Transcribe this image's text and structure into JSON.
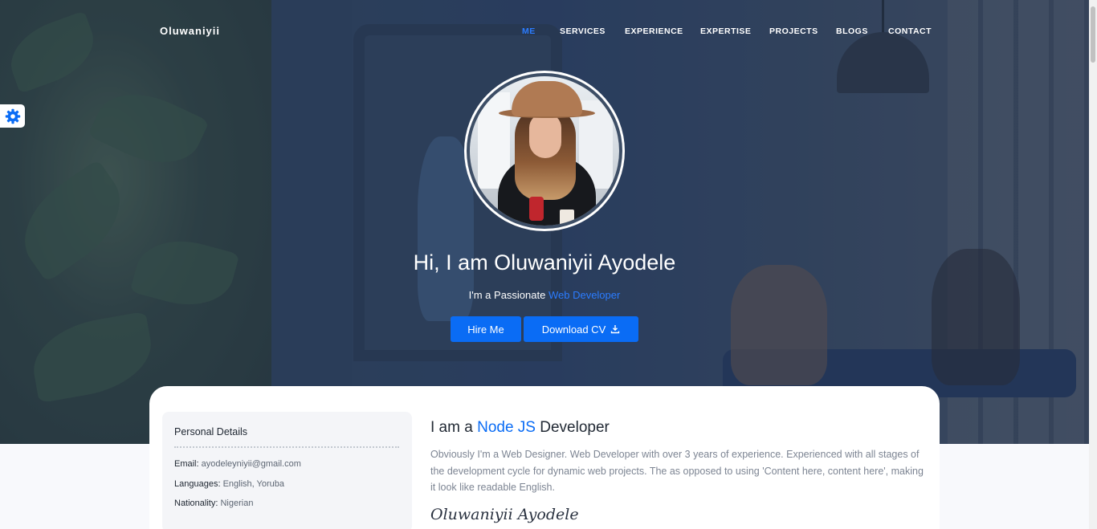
{
  "brand": "Oluwaniyii",
  "nav": {
    "items": [
      {
        "label": "ME",
        "active": true
      },
      {
        "label": "SERVICES",
        "active": false
      },
      {
        "label": "EXPERIENCE",
        "active": false
      },
      {
        "label": "EXPERTISE",
        "active": false
      },
      {
        "label": "PROJECTS",
        "active": false
      },
      {
        "label": "BLOGS",
        "active": false
      },
      {
        "label": "CONTACT",
        "active": false
      }
    ]
  },
  "settings": {
    "icon": "gear-icon"
  },
  "hero": {
    "title": "Hi, I am Oluwaniyii Ayodele",
    "subtitle_prefix": "I'm a Passionate",
    "subtitle_role": "Web Developer",
    "hire_label": "Hire Me",
    "cv_label": "Download CV",
    "cv_icon": "download-icon"
  },
  "personal_details": {
    "title": "Personal Details",
    "rows": [
      {
        "key": "Email:",
        "value": "ayodeleyniyii@gmail.com"
      },
      {
        "key": "Languages:",
        "value": "English, Yoruba"
      },
      {
        "key": "Nationality:",
        "value": "Nigerian"
      }
    ]
  },
  "about": {
    "heading_prefix": "I am a",
    "heading_accent": "Node JS",
    "heading_suffix": "Developer",
    "text": "Obviously I'm a Web Designer. Web Developer with over 3 years of experience. Experienced with all stages of the development cycle for dynamic web projects. The as opposed to using 'Content here, content here', making it look like readable English.",
    "signature": "Oluwaniyii Ayodele"
  },
  "colors": {
    "accent": "#0a6cf5",
    "nav_active": "#2b7cff"
  }
}
